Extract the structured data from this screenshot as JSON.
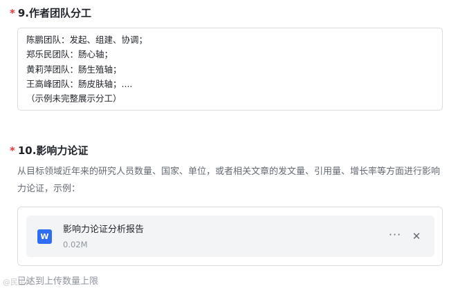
{
  "section9": {
    "star": "*",
    "title": "9.作者团队分工",
    "lines": [
      "陈鹏团队：发起、组建、协调；",
      "郑乐民团队：肠心轴；",
      "黄莉萍团队：肠生殖轴；",
      "王高峰团队：肠皮肤轴；....",
      "（示例未完整展示分工）"
    ]
  },
  "section10": {
    "star": "*",
    "title": "10.影响力论证",
    "description": "从目标领域近年来的研究人员数量、国家、单位，或者相关文章的发文量、引用量、增长率等方面进行影响力论证，示例：",
    "file": {
      "icon_letter": "W",
      "name": "影响力论证分析报告",
      "size": "0.02M",
      "more_glyph": "···",
      "close_glyph": "✕",
      "icon_color": "#2f6ef2"
    },
    "limit_text": "已达到上传数量上限"
  },
  "watermark": "@民主阵..."
}
